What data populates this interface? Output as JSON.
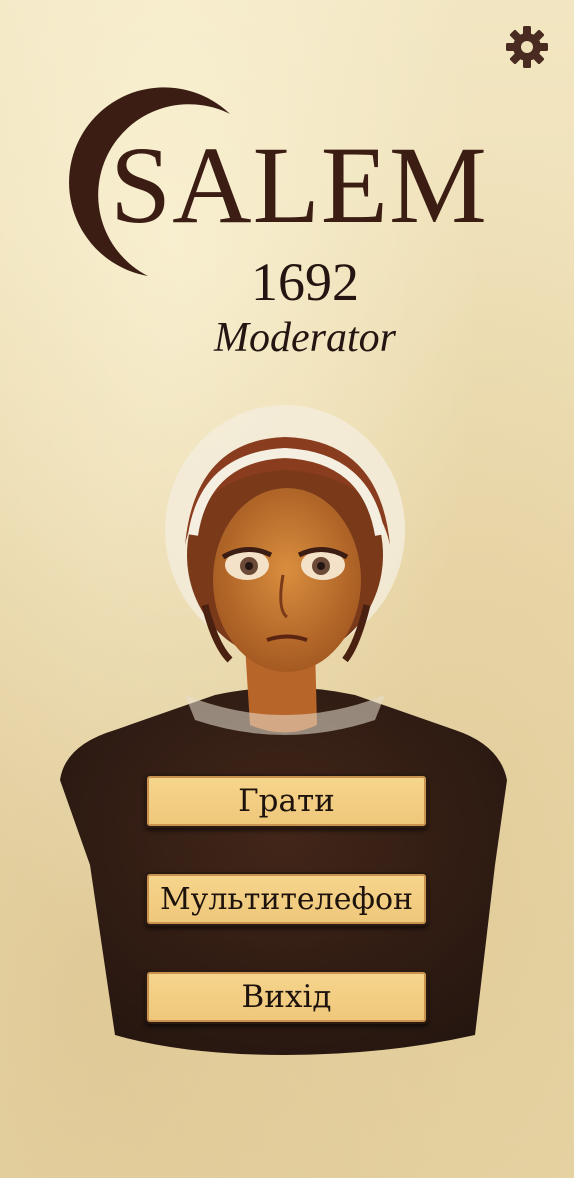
{
  "app": {
    "title": "SALEM",
    "year": "1692",
    "subtitle": "Moderator"
  },
  "icons": {
    "settings": "gear-icon",
    "logo_moon": "crescent-moon-icon"
  },
  "menu": {
    "play_label": "Грати",
    "multiphone_label": "Мультителефон",
    "exit_label": "Вихід"
  },
  "colors": {
    "background": "#efe1b8",
    "title": "#3b1d14",
    "button_fill": "#f2ce84",
    "button_border": "#2a1a10"
  }
}
